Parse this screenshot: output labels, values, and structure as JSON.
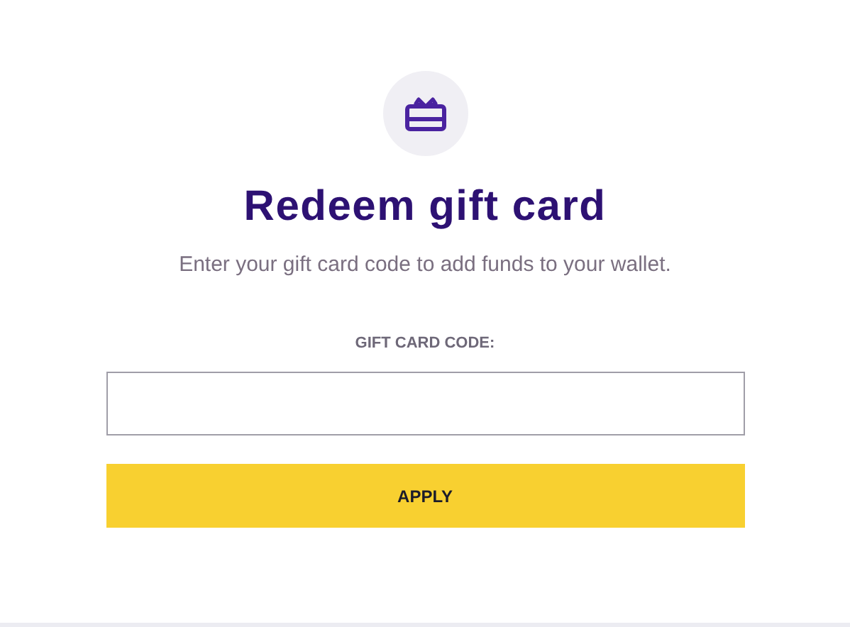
{
  "title": "Redeem gift card",
  "subtitle": "Enter your gift card code to add funds to your wallet.",
  "code_field": {
    "label": "GIFT CARD CODE:"
  },
  "buttons": [
    "APPLY"
  ]
}
